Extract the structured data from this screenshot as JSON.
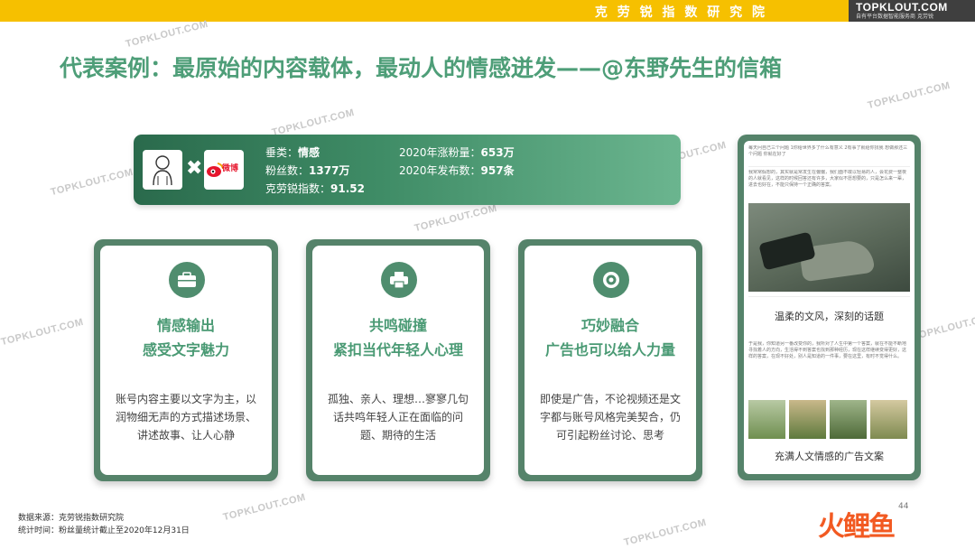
{
  "header": {
    "institute_name": "克 劳 锐 指 数 研 究 院",
    "brand_name": "TOPKLOUT.COM",
    "brand_tagline": "自有平台数据智能服务商",
    "brand_suffix": "克劳锐"
  },
  "page_title": "代表案例：最原始的内容载体，最动人的情感迸发——@东野先生的信箱",
  "watermark_text": "TOPKLOUT.COM",
  "profile": {
    "category_label": "垂类：",
    "category_value": "情感",
    "fans_label": "粉丝数：",
    "fans_value": "1377万",
    "index_label": "克劳锐指数：",
    "index_value": "91.52",
    "growth_label": "2020年涨粉量：",
    "growth_value": "653万",
    "posts_label": "2020年发布数：",
    "posts_value": "957条",
    "times_symbol": "✖",
    "weibo_logo_text": "微博"
  },
  "cards": [
    {
      "icon": "briefcase-icon",
      "heading_line1": "情感输出",
      "heading_line2": "感受文字魅力",
      "body": "账号内容主要以文字为主，以润物细无声的方式描述场景、讲述故事、让人心静"
    },
    {
      "icon": "printer-icon",
      "heading_line1": "共鸣碰撞",
      "heading_line2": "紧扣当代年轻人心理",
      "body": "孤独、亲人、理想…寥寥几句话共鸣年轻人正在面临的问题、期待的生活"
    },
    {
      "icon": "target-icon",
      "heading_line1": "巧妙融合",
      "heading_line2": "广告也可以给人力量",
      "body": "即使是广告，不论视频还是文字都与账号风格完美契合，仍可引起粉丝讨论、思考"
    }
  ],
  "phone": {
    "caption_top": "温柔的文风，深刻的话题",
    "caption_bottom": "充满人文情感的广告文案",
    "headline_small": "每天问自己三个问题 1你给世界多了什么有意义 2有事了就给你找我 想做那还三个问题 你就在好了",
    "post_small_1": "我常常假想的，其实就是常发生在偏偏，我们面不敢以轻易的人，会花费一整夜的人就看见，这样的时候回答还有许多，大家似不愿想要的，只是怎么来一辈，进去也好在，不能只保持一个正确的答案。",
    "post_small_2": "于是我，你知道另一番改变你的，我所对了人生中第一个答案，就在不能不断地寻找着人的方向，生活得不到答案也找到那种经历，现在这样继续变得更好，这样的答案，在现不好处，别人是知道的一件事，要在这里，有时不觉得什么。"
  },
  "footer": {
    "source": "数据来源：克劳锐指数研究院",
    "period": "统计时间：粉丝量统计截止至2020年12月31日"
  },
  "page_number": "44",
  "bottom_logo": "火鲤鱼",
  "colors": {
    "accent_green": "#4e9e78",
    "dark_green": "#2a6a4c",
    "card_frame": "#55836a",
    "top_bar_yellow": "#f6c000",
    "logo_orange": "#f25a22"
  }
}
